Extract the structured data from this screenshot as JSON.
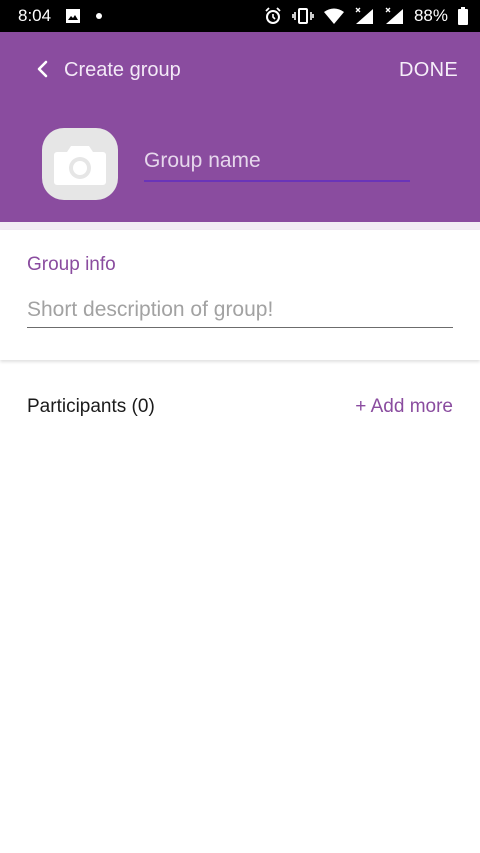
{
  "status_bar": {
    "time": "8:04",
    "battery": "88%",
    "icons": [
      "image-icon",
      "notification-dot-icon",
      "alarm-icon",
      "vibrate-icon",
      "wifi-icon",
      "signal-icon",
      "signal-icon",
      "battery-icon"
    ]
  },
  "appbar": {
    "title": "Create group",
    "done_label": "DONE",
    "background_color": "#8a4c9f"
  },
  "group_name": {
    "placeholder": "Group name",
    "value": ""
  },
  "group_info": {
    "label": "Group info",
    "placeholder": "Short description of group!",
    "value": ""
  },
  "participants": {
    "label": "Participants (0)",
    "add_more_label": "+ Add more"
  },
  "colors": {
    "accent": "#8a4c9f",
    "underline": "#6a34b8"
  }
}
